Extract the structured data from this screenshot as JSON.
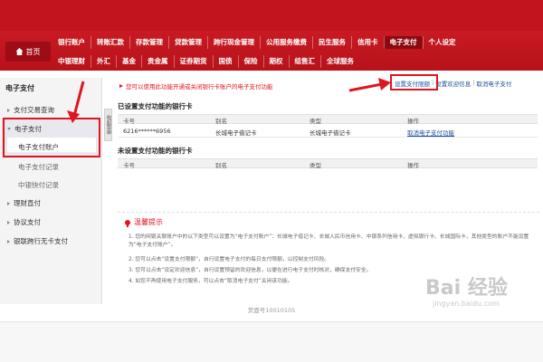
{
  "header": {
    "home_label": "首页",
    "nav_row1": [
      "银行账户",
      "转账汇款",
      "存款管理",
      "贷款管理",
      "跨行现金管理",
      "公用服务缴费",
      "民生服务",
      "信用卡",
      "电子支付",
      "个人设定"
    ],
    "nav_row2": [
      "中银理财",
      "外汇",
      "基金",
      "贵金属",
      "证券期货",
      "国债",
      "保险",
      "期权",
      "结售汇",
      "全球服务"
    ],
    "active_nav": "电子支付"
  },
  "sidebar": {
    "title": "电子支付",
    "items": [
      {
        "label": "支付交易查询",
        "expanded": false
      },
      {
        "label": "电子支付",
        "expanded": true
      },
      {
        "label": "电子支付账户",
        "sub": true,
        "selected": true
      },
      {
        "label": "电子支付记录",
        "sub": true
      },
      {
        "label": "中银快付记录",
        "sub": true
      },
      {
        "label": "理财直付",
        "expanded": false
      },
      {
        "label": "协议支付",
        "expanded": false
      },
      {
        "label": "银联跨行无卡支付",
        "expanded": false
      }
    ],
    "collapse_label": "收起菜单"
  },
  "main": {
    "notice": "您可以使用此功能开通或关闭银行卡账户的电子支付功能",
    "links": [
      "设置支付限额",
      "设置欢迎信息",
      "取消电子支付"
    ],
    "set_section": {
      "title": "已设置支付功能的银行卡",
      "headers": [
        "卡号",
        "别名",
        "类型",
        "操作"
      ],
      "rows": [
        {
          "card": "6216******6956",
          "alias": "长城电子借记卡",
          "type": "长城电子借记卡",
          "action": "取消电子支付功能"
        }
      ]
    },
    "unset_section": {
      "title": "未设置支付功能的银行卡",
      "headers": [
        "卡号",
        "别名",
        "类型",
        "操作"
      ]
    },
    "tips": {
      "title": "温馨提示",
      "items": [
        "1. 您的网银关联账户中的以下类型可以设置为“电子支付账户”：长城电子借记卡、长城人民币信用卡、中银系列信用卡、虚拟银行卡、长城国际卡，其他类型的账户不能设置为“电子支付账户”。",
        "2. 您可以点击“设置支付限额”，自行设置电子支付的每日支付限额，以控制支付风险。",
        "3. 您可以点击“设定欢迎信息”，自行设置预留的欢迎信息，以便在进行电子支付时核对，确保支付安全。",
        "4. 如您不再使用电子支付服务，可以点击“取消电子支付”关闭该功能。"
      ]
    }
  },
  "footer": {
    "page_id": "页面号10010105"
  },
  "watermark": {
    "text": "Bai 经验",
    "sub": "jingyan.baidu.com"
  }
}
